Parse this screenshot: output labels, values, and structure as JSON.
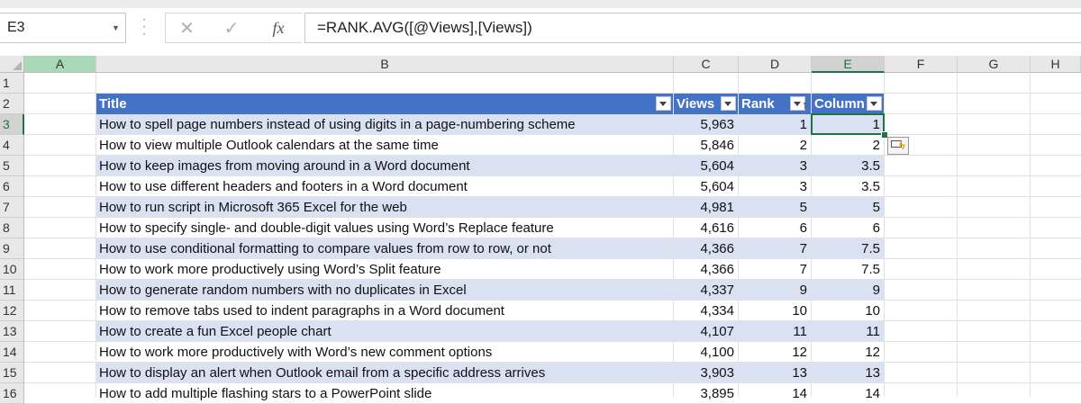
{
  "name_box": {
    "value": "E3"
  },
  "formula_bar": {
    "formula": "=RANK.AVG([@Views],[Views])",
    "cancel_glyph": "✕",
    "enter_glyph": "✓",
    "fx_label": "fx"
  },
  "column_headers": [
    "A",
    "B",
    "C",
    "D",
    "E",
    "F",
    "G",
    "H"
  ],
  "row_headers": [
    "1",
    "2",
    "3",
    "4",
    "5",
    "6",
    "7",
    "8",
    "9",
    "10",
    "11",
    "12",
    "13",
    "14",
    "15",
    "16"
  ],
  "table": {
    "headers": {
      "title": "Title",
      "views": "Views",
      "rank": "Rank",
      "column": "Column"
    },
    "rows": [
      {
        "title": "How to spell page numbers instead of using digits in a page-numbering scheme",
        "views": "5,963",
        "rank": "1",
        "column": "1"
      },
      {
        "title": "How to view multiple Outlook calendars at the same time",
        "views": "5,846",
        "rank": "2",
        "column": "2"
      },
      {
        "title": "How to keep images from moving around in a Word document",
        "views": "5,604",
        "rank": "3",
        "column": "3.5"
      },
      {
        "title": "How to use different headers and footers in a Word document",
        "views": "5,604",
        "rank": "3",
        "column": "3.5"
      },
      {
        "title": "How to run script in Microsoft 365 Excel for the web",
        "views": "4,981",
        "rank": "5",
        "column": "5"
      },
      {
        "title": "How to specify single- and double-digit values using Word’s Replace feature",
        "views": "4,616",
        "rank": "6",
        "column": "6"
      },
      {
        "title": "How to use conditional formatting to compare values from row to row, or not",
        "views": "4,366",
        "rank": "7",
        "column": "7.5"
      },
      {
        "title": "How to work more productively using Word’s Split feature",
        "views": "4,366",
        "rank": "7",
        "column": "7.5"
      },
      {
        "title": "How to generate random numbers with no duplicates in Excel",
        "views": "4,337",
        "rank": "9",
        "column": "9"
      },
      {
        "title": "How to remove tabs used to indent paragraphs in a Word document",
        "views": "4,334",
        "rank": "10",
        "column": "10"
      },
      {
        "title": "How to create a fun Excel people chart",
        "views": "4,107",
        "rank": "11",
        "column": "11"
      },
      {
        "title": "How to work more productively with Word’s new comment options",
        "views": "4,100",
        "rank": "12",
        "column": "12"
      },
      {
        "title": "How to display an alert when Outlook email from a specific address arrives",
        "views": "3,903",
        "rank": "13",
        "column": "13"
      },
      {
        "title": "How to add multiple flashing stars to a PowerPoint slide",
        "views": "3,895",
        "rank": "14",
        "column": "14"
      }
    ]
  },
  "colors": {
    "header_fill": "#4472c4",
    "band_fill": "#d9e1f2",
    "selection": "#217346"
  },
  "icons": {
    "quick_analysis": "quick-analysis-icon",
    "filter": "filter-dropdown-icon",
    "sort": "sort-ascending-icon"
  }
}
